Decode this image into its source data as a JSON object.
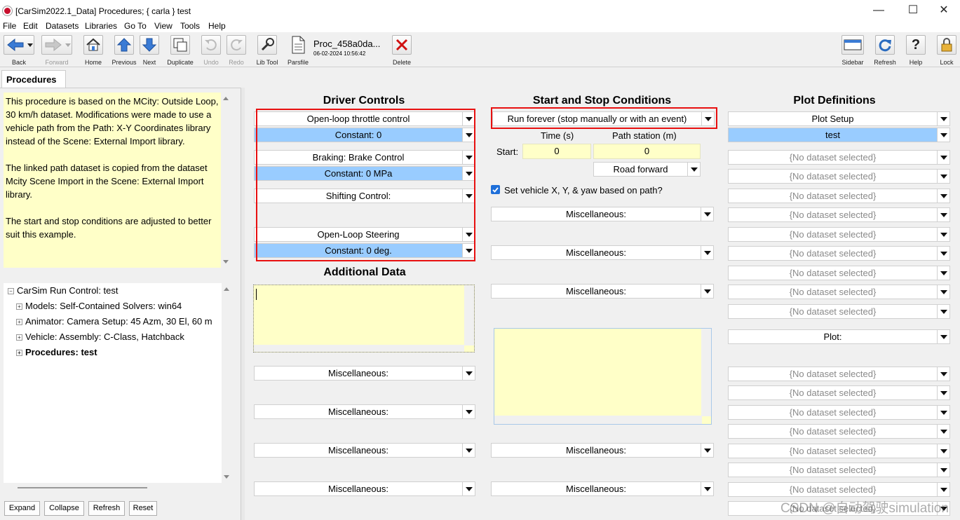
{
  "window": {
    "title": "[CarSim2022.1_Data] Procedures; { carla } test"
  },
  "menu": [
    "File",
    "Edit",
    "Datasets",
    "Libraries",
    "Go To",
    "View",
    "Tools",
    "Help"
  ],
  "toolbar": {
    "back": "Back",
    "forward": "Forward",
    "home": "Home",
    "previous": "Previous",
    "next": "Next",
    "duplicate": "Duplicate",
    "undo": "Undo",
    "redo": "Redo",
    "libtool": "Lib Tool",
    "parsfile": "Parsfile",
    "delete": "Delete",
    "sidebar": "Sidebar",
    "refresh": "Refresh",
    "help": "Help",
    "lock": "Lock",
    "proc_name": "Proc_458a0da...",
    "proc_date": "06-02-2024 10:56:42"
  },
  "left": {
    "tab": "Procedures",
    "notes": [
      "This procedure is based on the MCity: Outside Loop, 30 km/h dataset.  Modifications were made to use a vehicle path from the Path: X-Y Coordinates library instead of the Scene: External Import library.",
      "The linked path dataset is copied from the dataset Mcity Scene Import in the Scene: External Import library.",
      "The start and stop conditions are adjusted to better suit this example."
    ],
    "tree": [
      {
        "label": "CarSim Run Control: test",
        "bold": false
      },
      {
        "label": "Models: Self-Contained Solvers: win64",
        "bold": false
      },
      {
        "label": "Animator: Camera Setup: 45 Azm, 30 El, 60 m",
        "bold": false
      },
      {
        "label": "Vehicle: Assembly: C-Class, Hatchback",
        "bold": false
      },
      {
        "label": "Procedures: test",
        "bold": true
      }
    ],
    "buttons": {
      "expand": "Expand",
      "collapse": "Collapse",
      "refresh": "Refresh",
      "reset": "Reset"
    }
  },
  "driver": {
    "heading": "Driver Controls",
    "throttle": "Open-loop throttle control",
    "throttle_val": "Constant: 0",
    "braking": "Braking: Brake Control",
    "braking_val": "Constant: 0 MPa",
    "shifting": "Shifting Control:",
    "steering": "Open-Loop Steering",
    "steering_val": "Constant: 0 deg."
  },
  "additional": {
    "heading": "Additional Data"
  },
  "misc_label": "Miscellaneous:",
  "startstop": {
    "heading": "Start and Stop Conditions",
    "run_mode": "Run forever (stop manually or with an event)",
    "time_label": "Time (s)",
    "station_label": "Path station (m)",
    "start_label": "Start:",
    "start_time": "0",
    "start_station": "0",
    "road_dir": "Road forward",
    "set_xy_label": "Set vehicle X, Y, & yaw based on path?"
  },
  "plots": {
    "heading": "Plot Definitions",
    "setup": "Plot Setup",
    "setup_val": "test",
    "none": "{No dataset selected}",
    "plot": "Plot:"
  },
  "watermark": "CSDN @自动驾驶simulation"
}
